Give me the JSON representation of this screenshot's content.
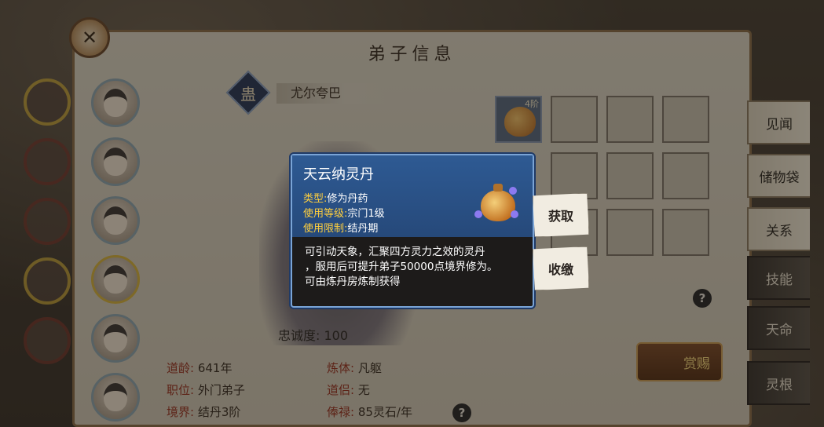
{
  "panel": {
    "title": "弟子信息"
  },
  "disciple": {
    "seal_char": "蛊",
    "name": "尤尔夸巴",
    "loyalty_label": "忠诚度:",
    "loyalty_value": "100"
  },
  "stats": {
    "age_label": "道龄:",
    "age_value": "641年",
    "position_label": "职位:",
    "position_value": "外门弟子",
    "realm_label": "境界:",
    "realm_value": "结丹3阶",
    "body_label": "炼体:",
    "body_value": "凡躯",
    "partner_label": "道侣:",
    "partner_value": "无",
    "salary_label": "俸禄:",
    "salary_value": "85灵石/年"
  },
  "inventory": {
    "slot1_tier": "4阶"
  },
  "tabs": [
    "见闻",
    "储物袋",
    "关系",
    "技能",
    "天命",
    "灵根"
  ],
  "popup": {
    "title": "天云纳灵丹",
    "type_label": "类型:",
    "type_value": "修为丹药",
    "level_label": "使用等级:",
    "level_value": "宗门1级",
    "limit_label": "使用限制:",
    "limit_value": "结丹期",
    "description": [
      "可引动天象，汇聚四方灵力之效的灵丹",
      "，服用后可提升弟子50000点境界修为。",
      "可由炼丹房炼制获得"
    ]
  },
  "actions": {
    "take": "获取",
    "store": "收缴"
  },
  "reward": {
    "label": "赏赐"
  },
  "help_glyph": "?",
  "colors": {
    "popup_header": "#2e5a93",
    "key_label": "#ffcf3e",
    "stat_key": "#9a3322"
  }
}
